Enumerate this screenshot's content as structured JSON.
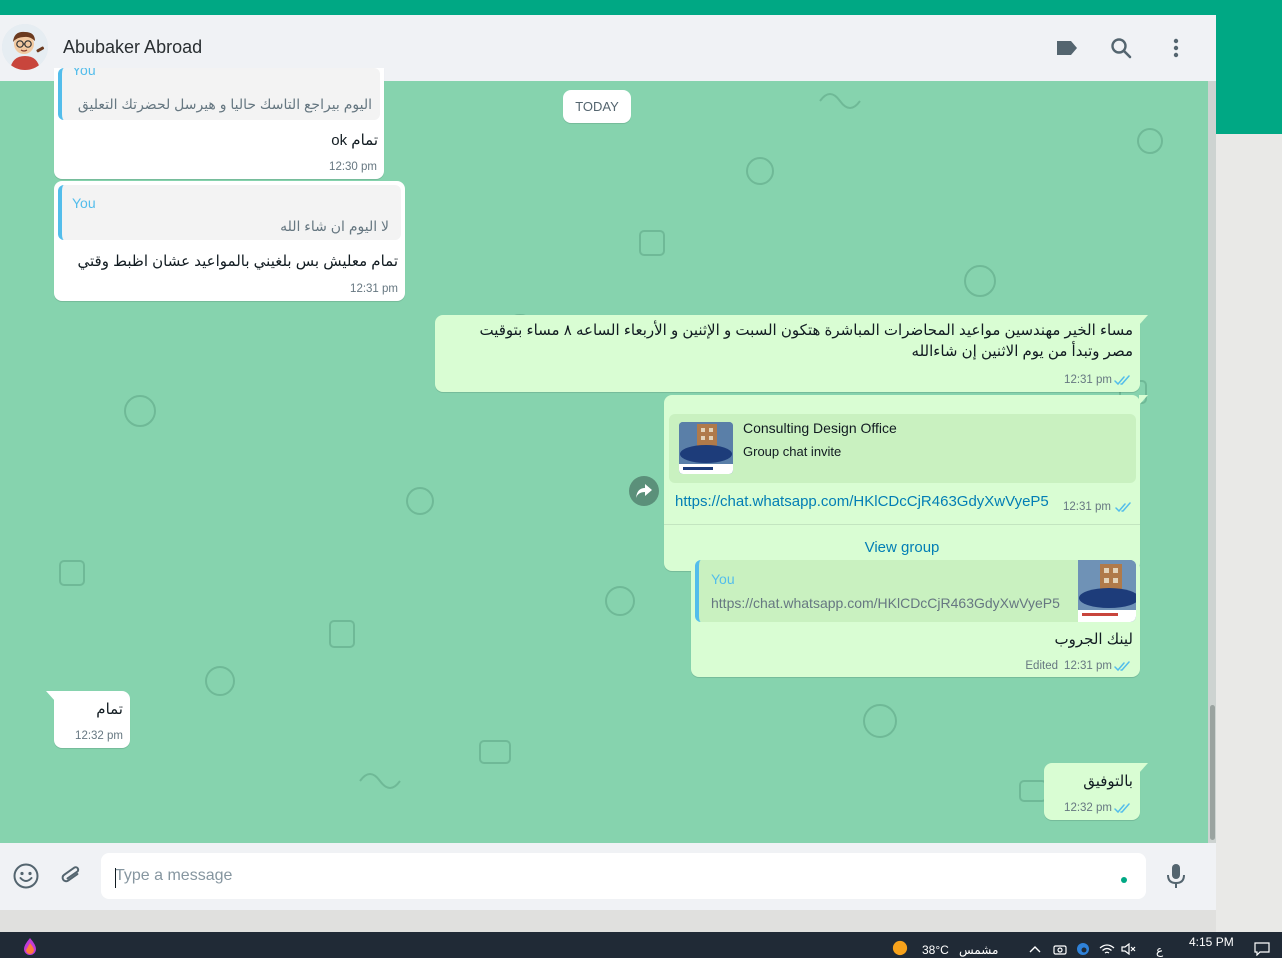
{
  "colors": {
    "accent": "#00a884",
    "chat_bg": "#86d3ae",
    "incoming_bubble": "#ffffff",
    "outgoing_bubble": "#d9fdd3",
    "quote_bar": "#53bdeb",
    "link": "#027eb5",
    "read_ticks": "#53bdeb"
  },
  "header": {
    "contact_name": "Abubaker Abroad",
    "icons": [
      "label-icon",
      "search-icon",
      "menu-icon"
    ]
  },
  "date_divider": "TODAY",
  "messages": [
    {
      "direction": "in",
      "quote": {
        "author": "You",
        "text": "اليوم بيراجع التاسك حاليا و هيرسل لحضرتك التعليق"
      },
      "text": "تمام ok",
      "time": "12:30 pm"
    },
    {
      "direction": "in",
      "quote": {
        "author": "You",
        "text": "لا اليوم ان شاء الله"
      },
      "text": "تمام معليش بس بلغيني بالمواعيد عشان اظبط وقتي",
      "time": "12:31 pm"
    },
    {
      "direction": "out",
      "text": "مساء الخير مهندسين مواعيد المحاضرات المباشرة هتكون السبت و الإثنين و الأربعاء الساعه ٨ مساء بتوقيت مصر وتبدأ من يوم الاثنين إن شاءالله",
      "time": "12:31 pm"
    },
    {
      "direction": "out",
      "preview": {
        "title": "Consulting Design Office",
        "subtitle": "Group chat invite"
      },
      "link": "https://chat.whatsapp.com/HKlCDcCjR463GdyXwVyeP5",
      "time": "12:31 pm",
      "action": "View group"
    },
    {
      "direction": "out",
      "quote": {
        "author": "You",
        "text": "https://chat.whatsapp.com/HKlCDcCjR463GdyXwVyeP5"
      },
      "text": "لينك الجروب",
      "edited": "Edited",
      "time": "12:31 pm"
    },
    {
      "direction": "in",
      "text": "تمام",
      "time": "12:32 pm"
    },
    {
      "direction": "out",
      "text": "بالتوفيق",
      "time": "12:32 pm"
    }
  ],
  "composer": {
    "placeholder": "Type a message",
    "icons": [
      "emoji-icon",
      "attach-icon",
      "microphone-icon"
    ]
  },
  "taskbar": {
    "temperature": "38°C",
    "weather": "مشمس",
    "input_lang": "ع",
    "time": "4:15 PM"
  }
}
